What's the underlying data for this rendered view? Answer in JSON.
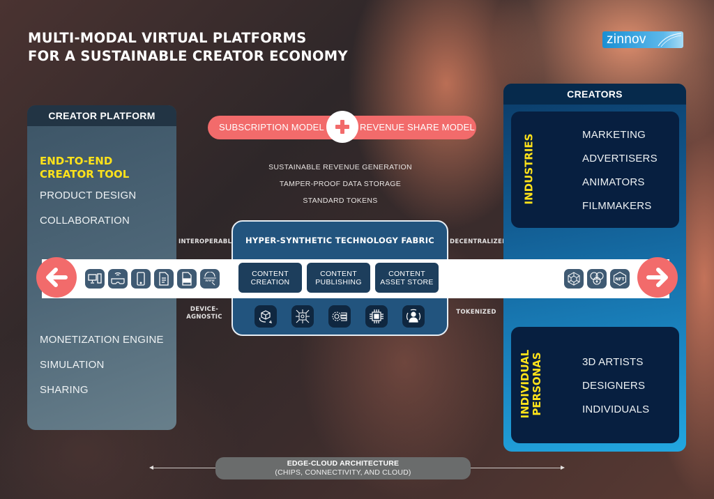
{
  "title": {
    "line1": "MULTI-MODAL VIRTUAL PLATFORMS",
    "line2": "FOR A SUSTAINABLE CREATOR ECONOMY"
  },
  "logo": {
    "text": "zinnov",
    "color": "#1a8fd3"
  },
  "creator_platform": {
    "heading": "CREATOR PLATFORM",
    "highlight_line1": "END-TO-END",
    "highlight_line2": "CREATOR TOOL",
    "items_top": [
      "PRODUCT DESIGN",
      "COLLABORATION"
    ],
    "items_bottom": [
      "MONETIZATION ENGINE",
      "SIMULATION",
      "SHARING"
    ],
    "highlight_color": "#ffe21a"
  },
  "models": {
    "left": "SUBSCRIPTION MODEL",
    "right": "REVENUE SHARE MODEL",
    "joiner_icon": "plus-icon",
    "color": "#f26b6b"
  },
  "features": [
    "SUSTAINABLE REVENUE GENERATION",
    "TAMPER-PROOF DATA STORAGE",
    "STANDARD TOKENS"
  ],
  "side_labels": {
    "top_left": "INTEROPERABLE",
    "top_right": "DECENTRALIZED",
    "bottom_left_line1": "DEVICE-",
    "bottom_left_line2": "AGNOSTIC",
    "bottom_right": "TOKENIZED"
  },
  "fabric": {
    "title": "HYPER-SYNTHETIC TECHNOLOGY FABRIC",
    "content_boxes": [
      {
        "line1": "CONTENT",
        "line2": "CREATION"
      },
      {
        "line1": "CONTENT",
        "line2": "PUBLISHING"
      },
      {
        "line1": "CONTENT",
        "line2": "ASSET STORE"
      }
    ],
    "tech_icons": [
      "3d-cube-rotate-icon",
      "neural-network-icon",
      "gear-pipeline-icon",
      "chip-icon",
      "avatar-hologram-icon"
    ]
  },
  "band": {
    "left_arrow": "arrow-left-icon",
    "right_arrow": "arrow-right-icon",
    "device_icons": [
      "desktop-computer-icon",
      "vr-headset-icon",
      "smartphone-icon",
      "document-icon",
      "pdf-file-icon",
      "www-web-icon"
    ],
    "token_icons": [
      "blockchain-cube-icon",
      "crypto-coins-icon",
      "nft-icon"
    ],
    "nft_text": "NFT"
  },
  "creators": {
    "heading": "CREATORS",
    "groups": [
      {
        "label": "INDUSTRIES",
        "items": [
          "MARKETING",
          "ADVERTISERS",
          "ANIMATORS",
          "FILMMAKERS"
        ]
      },
      {
        "label_line1": "INDIVIDUAL",
        "label_line2": "PERSONAS",
        "items": [
          "3D ARTISTS",
          "DESIGNERS",
          "INDIVIDUALS"
        ]
      }
    ]
  },
  "edge_cloud": {
    "title": "EDGE-CLOUD ARCHITECTURE",
    "subtitle": "(CHIPS, CONNECTIVITY, AND CLOUD)"
  }
}
